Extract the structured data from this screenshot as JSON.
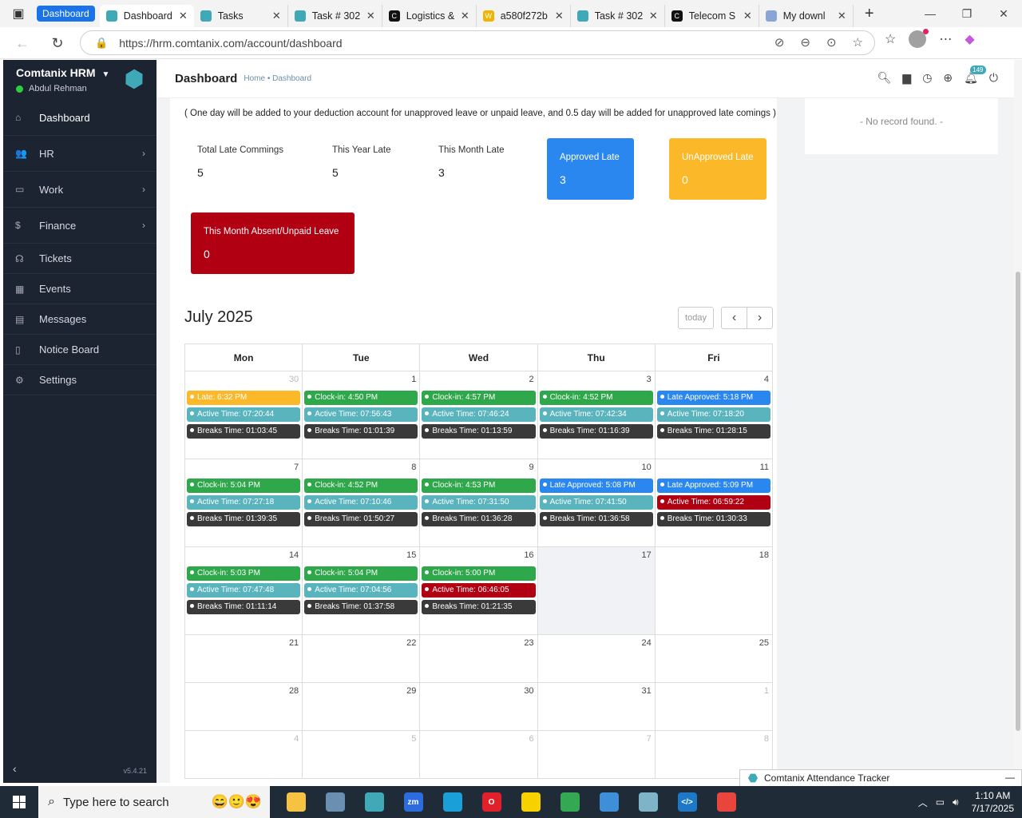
{
  "browser": {
    "tab_group": "Dashboard",
    "tabs": [
      {
        "title": "Dashboard",
        "active": true,
        "fav": "#3fa9b8",
        "fav_glyph": ""
      },
      {
        "title": "Tasks",
        "active": false,
        "fav": "#3fa9b8",
        "fav_glyph": ""
      },
      {
        "title": "Task # 302",
        "active": false,
        "fav": "#3fa9b8",
        "fav_glyph": ""
      },
      {
        "title": "Logistics &",
        "active": false,
        "fav": "#111111",
        "fav_glyph": "C"
      },
      {
        "title": "a580f272b",
        "active": false,
        "fav": "#f0b400",
        "fav_glyph": "W"
      },
      {
        "title": "Task # 302",
        "active": false,
        "fav": "#3fa9b8",
        "fav_glyph": ""
      },
      {
        "title": "Telecom S",
        "active": false,
        "fav": "#111111",
        "fav_glyph": "C"
      },
      {
        "title": "My downl",
        "active": false,
        "fav": "#8aa4d8",
        "fav_glyph": ""
      }
    ],
    "url": "https://hrm.comtanix.com/account/dashboard"
  },
  "sidebar": {
    "brand": "Comtanix HRM",
    "user": "Abdul Rehman",
    "items": [
      {
        "label": "Dashboard",
        "icon": "home-icon",
        "glyph": "⌂",
        "chevron": false
      },
      {
        "label": "HR",
        "icon": "users-icon",
        "glyph": "👥",
        "chevron": true
      },
      {
        "label": "Work",
        "icon": "briefcase-icon",
        "glyph": "▭",
        "chevron": true
      },
      {
        "label": "Finance",
        "icon": "dollar-icon",
        "glyph": "$",
        "chevron": true
      },
      {
        "label": "Tickets",
        "icon": "headset-icon",
        "glyph": "☊",
        "chevron": false
      },
      {
        "label": "Events",
        "icon": "calendar-icon",
        "glyph": "▦",
        "chevron": false
      },
      {
        "label": "Messages",
        "icon": "message-icon",
        "glyph": "▤",
        "chevron": false
      },
      {
        "label": "Notice Board",
        "icon": "clipboard-icon",
        "glyph": "▯",
        "chevron": false
      },
      {
        "label": "Settings",
        "icon": "gear-icon",
        "glyph": "⚙",
        "chevron": false
      }
    ],
    "version": "v5.4.21"
  },
  "topbar": {
    "title": "Dashboard",
    "crumb_home": "Home",
    "crumb_sep": "•",
    "crumb_current": "Dashboard",
    "notifications": "149"
  },
  "main": {
    "note": "( One day will be added to your deduction account for unapproved leave or unpaid leave, and 0.5 day will be added for unapproved late comings )",
    "stats": [
      {
        "label": "Total Late Commings",
        "value": "5"
      },
      {
        "label": "This Year Late",
        "value": "5"
      },
      {
        "label": "This Month Late",
        "value": "3"
      }
    ],
    "boxes": {
      "approved": {
        "label": "Approved Late",
        "value": "3",
        "color": "#2b87f0"
      },
      "unapproved": {
        "label": "UnApproved Late",
        "value": "0",
        "color": "#fbb92a"
      },
      "absent": {
        "label": "This Month Absent/Unpaid Leave",
        "value": "0",
        "color": "#b00012"
      }
    },
    "side_card": "- No record found. -"
  },
  "calendar": {
    "title": "July 2025",
    "today_label": "today",
    "prev": "‹",
    "next": "›",
    "weekdays": [
      "Mon",
      "Tue",
      "Wed",
      "Thu",
      "Fri"
    ],
    "colors": {
      "late": "#fbb92a",
      "clock": "#2ea84a",
      "active": "#5ab4be",
      "breaks": "#3a3a3a",
      "approved": "#2b87f0",
      "low": "#b00012"
    },
    "weeks": [
      [
        {
          "day": "30",
          "other": true,
          "events": [
            [
              "late",
              "Late: 6:32 PM"
            ],
            [
              "active",
              "Active Time: 07:20:44"
            ],
            [
              "breaks",
              "Breaks Time: 01:03:45"
            ]
          ]
        },
        {
          "day": "1",
          "events": [
            [
              "clock",
              "Clock-in: 4:50 PM"
            ],
            [
              "active",
              "Active Time: 07:56:43"
            ],
            [
              "breaks",
              "Breaks Time: 01:01:39"
            ]
          ]
        },
        {
          "day": "2",
          "events": [
            [
              "clock",
              "Clock-in: 4:57 PM"
            ],
            [
              "active",
              "Active Time: 07:46:24"
            ],
            [
              "breaks",
              "Breaks Time: 01:13:59"
            ]
          ]
        },
        {
          "day": "3",
          "events": [
            [
              "clock",
              "Clock-in: 4:52 PM"
            ],
            [
              "active",
              "Active Time: 07:42:34"
            ],
            [
              "breaks",
              "Breaks Time: 01:16:39"
            ]
          ]
        },
        {
          "day": "4",
          "events": [
            [
              "approved",
              "Late Approved: 5:18 PM"
            ],
            [
              "active",
              "Active Time: 07:18:20"
            ],
            [
              "breaks",
              "Breaks Time: 01:28:15"
            ]
          ]
        }
      ],
      [
        {
          "day": "7",
          "events": [
            [
              "clock",
              "Clock-in: 5:04 PM"
            ],
            [
              "active",
              "Active Time: 07:27:18"
            ],
            [
              "breaks",
              "Breaks Time: 01:39:35"
            ]
          ]
        },
        {
          "day": "8",
          "events": [
            [
              "clock",
              "Clock-in: 4:52 PM"
            ],
            [
              "active",
              "Active Time: 07:10:46"
            ],
            [
              "breaks",
              "Breaks Time: 01:50:27"
            ]
          ]
        },
        {
          "day": "9",
          "events": [
            [
              "clock",
              "Clock-in: 4:53 PM"
            ],
            [
              "active",
              "Active Time: 07:31:50"
            ],
            [
              "breaks",
              "Breaks Time: 01:36:28"
            ]
          ]
        },
        {
          "day": "10",
          "events": [
            [
              "approved",
              "Late Approved: 5:08 PM"
            ],
            [
              "active",
              "Active Time: 07:41:50"
            ],
            [
              "breaks",
              "Breaks Time: 01:36:58"
            ]
          ]
        },
        {
          "day": "11",
          "events": [
            [
              "approved",
              "Late Approved: 5:09 PM"
            ],
            [
              "low",
              "Active Time: 06:59:22"
            ],
            [
              "breaks",
              "Breaks Time: 01:30:33"
            ]
          ]
        }
      ],
      [
        {
          "day": "14",
          "events": [
            [
              "clock",
              "Clock-in: 5:03 PM"
            ],
            [
              "active",
              "Active Time: 07:47:48"
            ],
            [
              "breaks",
              "Breaks Time: 01:11:14"
            ]
          ]
        },
        {
          "day": "15",
          "events": [
            [
              "clock",
              "Clock-in: 5:04 PM"
            ],
            [
              "active",
              "Active Time: 07:04:56"
            ],
            [
              "breaks",
              "Breaks Time: 01:37:58"
            ]
          ]
        },
        {
          "day": "16",
          "events": [
            [
              "clock",
              "Clock-in: 5:00 PM"
            ],
            [
              "low",
              "Active Time: 06:46:05"
            ],
            [
              "breaks",
              "Breaks Time: 01:21:35"
            ]
          ]
        },
        {
          "day": "17",
          "today": true,
          "events": []
        },
        {
          "day": "18",
          "events": []
        }
      ],
      [
        {
          "day": "21",
          "events": []
        },
        {
          "day": "22",
          "events": []
        },
        {
          "day": "23",
          "events": []
        },
        {
          "day": "24",
          "events": []
        },
        {
          "day": "25",
          "events": []
        }
      ],
      [
        {
          "day": "28",
          "events": []
        },
        {
          "day": "29",
          "events": []
        },
        {
          "day": "30",
          "events": []
        },
        {
          "day": "31",
          "events": []
        },
        {
          "day": "1",
          "other": true,
          "events": []
        }
      ],
      [
        {
          "day": "4",
          "other": true,
          "events": []
        },
        {
          "day": "5",
          "other": true,
          "events": []
        },
        {
          "day": "6",
          "other": true,
          "events": []
        },
        {
          "day": "7",
          "other": true,
          "events": []
        },
        {
          "day": "8",
          "other": true,
          "events": []
        }
      ]
    ]
  },
  "tracker": {
    "title": "Comtanix Attendance Tracker"
  },
  "taskbar": {
    "search_placeholder": "Type here to search",
    "apps": [
      {
        "name": "file-explorer-icon",
        "color": "#f5c242",
        "glyph": ""
      },
      {
        "name": "app-icon",
        "color": "#6b8fb0",
        "glyph": ""
      },
      {
        "name": "comtanix-app-icon",
        "color": "#3fa9b8",
        "glyph": ""
      },
      {
        "name": "zoom-icon",
        "color": "#2d6cdf",
        "glyph": "zm"
      },
      {
        "name": "edge-icon",
        "color": "#1a9fd8",
        "glyph": ""
      },
      {
        "name": "opera-icon",
        "color": "#e0202a",
        "glyph": "O"
      },
      {
        "name": "sticky-notes-icon",
        "color": "#f7d100",
        "glyph": ""
      },
      {
        "name": "chrome-icon",
        "color": "#34a853",
        "glyph": ""
      },
      {
        "name": "photos-icon",
        "color": "#3c8fd8",
        "glyph": ""
      },
      {
        "name": "app2-icon",
        "color": "#7fb3c8",
        "glyph": ""
      },
      {
        "name": "vscode-icon",
        "color": "#1e78c8",
        "glyph": "</>"
      },
      {
        "name": "chrome2-icon",
        "color": "#e8453c",
        "glyph": ""
      }
    ],
    "time": "1:10 AM",
    "date": "7/17/2025"
  }
}
